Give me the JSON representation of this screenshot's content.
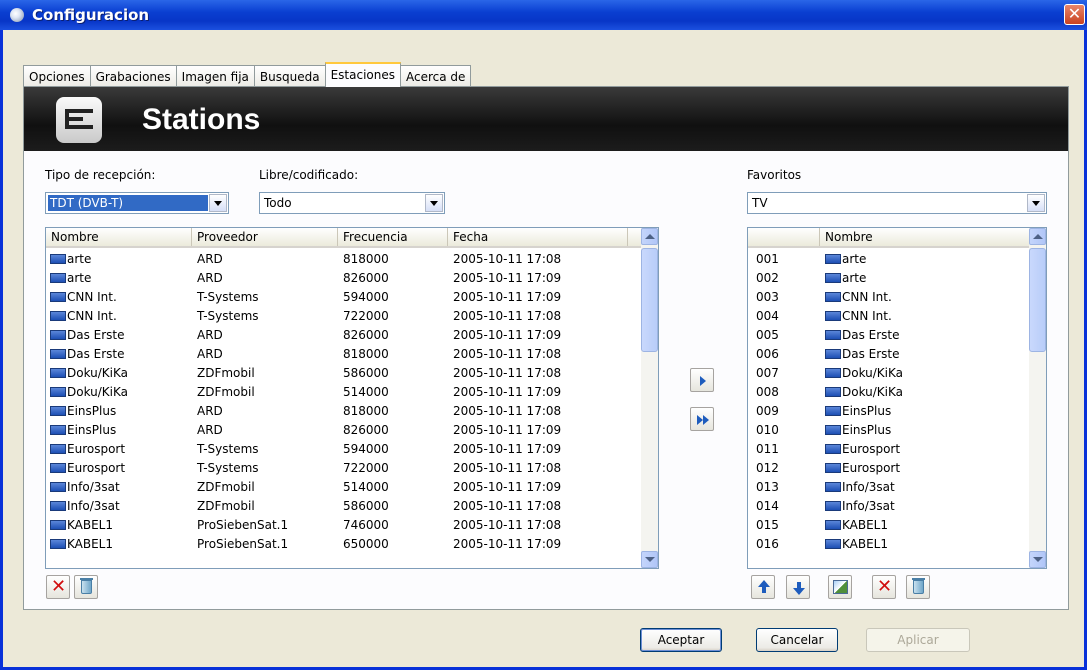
{
  "window": {
    "title": "Configuracion"
  },
  "tabs": [
    {
      "label": "Opciones"
    },
    {
      "label": "Grabaciones"
    },
    {
      "label": "Imagen fija"
    },
    {
      "label": "Busqueda"
    },
    {
      "label": "Estaciones"
    },
    {
      "label": "Acerca de"
    }
  ],
  "active_tab": "Estaciones",
  "banner": {
    "title": "Stations"
  },
  "filters": {
    "reception_label": "Tipo de recepción:",
    "reception_value": "TDT (DVB-T)",
    "scrambled_label": "Libre/codificado:",
    "scrambled_value": "Todo",
    "favorites_label": "Favoritos",
    "favorites_value": "TV"
  },
  "stations": {
    "columns": [
      "Nombre",
      "Proveedor",
      "Frecuencia",
      "Fecha"
    ],
    "rows": [
      [
        "arte",
        "ARD",
        "818000",
        "2005-10-11 17:08"
      ],
      [
        "arte",
        "ARD",
        "826000",
        "2005-10-11 17:09"
      ],
      [
        "CNN Int.",
        "T-Systems",
        "594000",
        "2005-10-11 17:09"
      ],
      [
        "CNN Int.",
        "T-Systems",
        "722000",
        "2005-10-11 17:08"
      ],
      [
        "Das Erste",
        "ARD",
        "826000",
        "2005-10-11 17:09"
      ],
      [
        "Das Erste",
        "ARD",
        "818000",
        "2005-10-11 17:08"
      ],
      [
        "Doku/KiKa",
        "ZDFmobil",
        "586000",
        "2005-10-11 17:08"
      ],
      [
        "Doku/KiKa",
        "ZDFmobil",
        "514000",
        "2005-10-11 17:09"
      ],
      [
        "EinsPlus",
        "ARD",
        "818000",
        "2005-10-11 17:08"
      ],
      [
        "EinsPlus",
        "ARD",
        "826000",
        "2005-10-11 17:09"
      ],
      [
        "Eurosport",
        "T-Systems",
        "594000",
        "2005-10-11 17:09"
      ],
      [
        "Eurosport",
        "T-Systems",
        "722000",
        "2005-10-11 17:08"
      ],
      [
        "Info/3sat",
        "ZDFmobil",
        "514000",
        "2005-10-11 17:09"
      ],
      [
        "Info/3sat",
        "ZDFmobil",
        "586000",
        "2005-10-11 17:08"
      ],
      [
        "KABEL1",
        "ProSiebenSat.1",
        "746000",
        "2005-10-11 17:08"
      ],
      [
        "KABEL1",
        "ProSiebenSat.1",
        "650000",
        "2005-10-11 17:09"
      ]
    ]
  },
  "favorites": {
    "columns": [
      "",
      "Nombre"
    ],
    "rows": [
      [
        "001",
        "arte"
      ],
      [
        "002",
        "arte"
      ],
      [
        "003",
        "CNN Int."
      ],
      [
        "004",
        "CNN Int."
      ],
      [
        "005",
        "Das Erste"
      ],
      [
        "006",
        "Das Erste"
      ],
      [
        "007",
        "Doku/KiKa"
      ],
      [
        "008",
        "Doku/KiKa"
      ],
      [
        "009",
        "EinsPlus"
      ],
      [
        "010",
        "EinsPlus"
      ],
      [
        "011",
        "Eurosport"
      ],
      [
        "012",
        "Eurosport"
      ],
      [
        "013",
        "Info/3sat"
      ],
      [
        "014",
        "Info/3sat"
      ],
      [
        "015",
        "KABEL1"
      ],
      [
        "016",
        "KABEL1"
      ]
    ]
  },
  "buttons": {
    "ok": "Aceptar",
    "cancel": "Cancelar",
    "apply": "Aplicar"
  }
}
